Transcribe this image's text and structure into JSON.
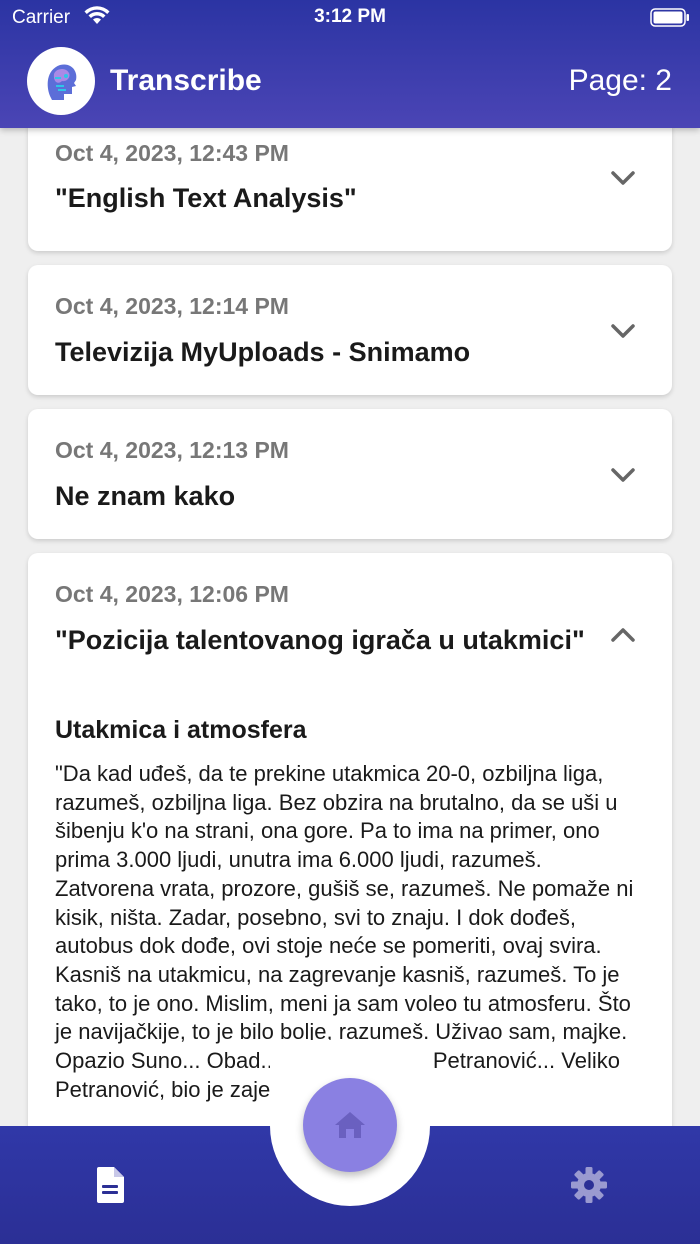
{
  "status_bar": {
    "carrier": "Carrier",
    "time": "3:12 PM"
  },
  "header": {
    "title": "Transcribe",
    "page_label": "Page: 2"
  },
  "cards": [
    {
      "date": "Oct 4, 2023, 12:43 PM",
      "title": "\"English Text Analysis\""
    },
    {
      "date": "Oct 4, 2023, 12:14 PM",
      "title": "Televizija MyUploads - Snimamo"
    },
    {
      "date": "Oct 4, 2023, 12:13 PM",
      "title": "Ne znam kako"
    },
    {
      "date": "Oct 4, 2023, 12:06 PM",
      "title": "\"Pozicija talentovanog igrača u utakmici\"",
      "section_heading": "Utakmica i atmosfera",
      "body": "\"Da kad uđeš, da te prekine utakmica 20-0, ozbiljna liga, razumeš, ozbiljna liga. Bez obzira na brutalno, da se uši u šibenju k'o na strani, ona gore. Pa to ima na primer, ono prima 3.000 ljudi, unutra ima 6.000 ljudi, razumeš. Zatvorena vrata, prozore, gušiš se, razumeš. Ne pomaže ni kisik, ništa. Zadar, posebno, svi to znaju. I dok dođeš, autobus dok dođe, ovi stoje neće se pomeriti, ovaj svira. Kasniš na utakmicu, na zagrevanje kasniš, razumeš. To je tako, to je ono. Mislim, meni ja sam voleo tu atmosferu. Što je navijačkije, to je bilo bolje, razumeš. Uživao sam, majke. Opazio Suno... Obad... Paklić... Veliko Petranović... Veliko Petranović, bio je zajebani igrač."
    }
  ],
  "icons": {
    "wifi": "wifi-icon",
    "battery": "battery-icon",
    "logo": "brain-head-logo-icon",
    "chevron_down": "chevron-down-icon",
    "chevron_up": "chevron-up-icon",
    "home": "home-icon",
    "documents": "document-icon",
    "settings": "gear-icon"
  },
  "colors": {
    "header": "#2b34a3",
    "nav_bar": "#2b2f95",
    "fab": "#8a80e2",
    "nav_icon": "#ffffff",
    "settings_icon": "#9a9ad0",
    "home_icon": "#6a60c0"
  }
}
